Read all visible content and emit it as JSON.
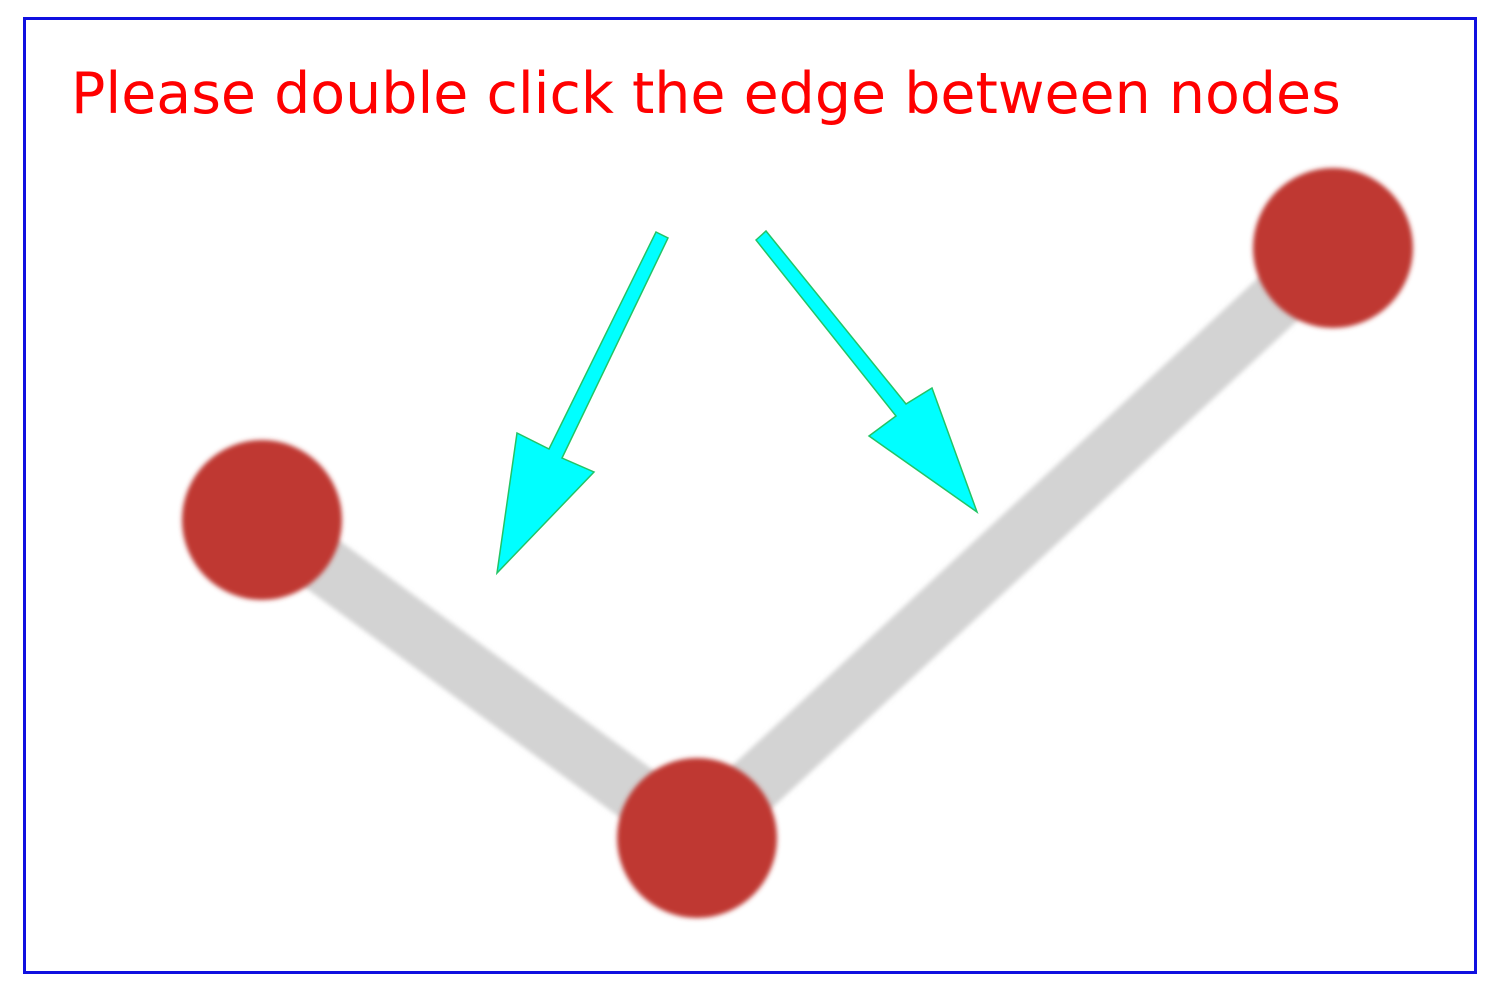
{
  "instruction": {
    "text": "Please double click the edge between nodes",
    "color": "#ff0000"
  },
  "frame": {
    "border_color": "#1010e0"
  },
  "graph": {
    "node_color": "#bf3833",
    "edge_color": "#d3d3d3",
    "nodes": [
      {
        "id": "node-left"
      },
      {
        "id": "node-bottom"
      },
      {
        "id": "node-right"
      }
    ],
    "edges": [
      {
        "from": "node-left",
        "to": "node-bottom"
      },
      {
        "from": "node-bottom",
        "to": "node-right"
      }
    ]
  },
  "hint_arrows": {
    "color": "#00ffff",
    "outline_color": "#22c466",
    "icons": [
      "arrow-down-left-icon",
      "arrow-down-right-icon"
    ]
  }
}
